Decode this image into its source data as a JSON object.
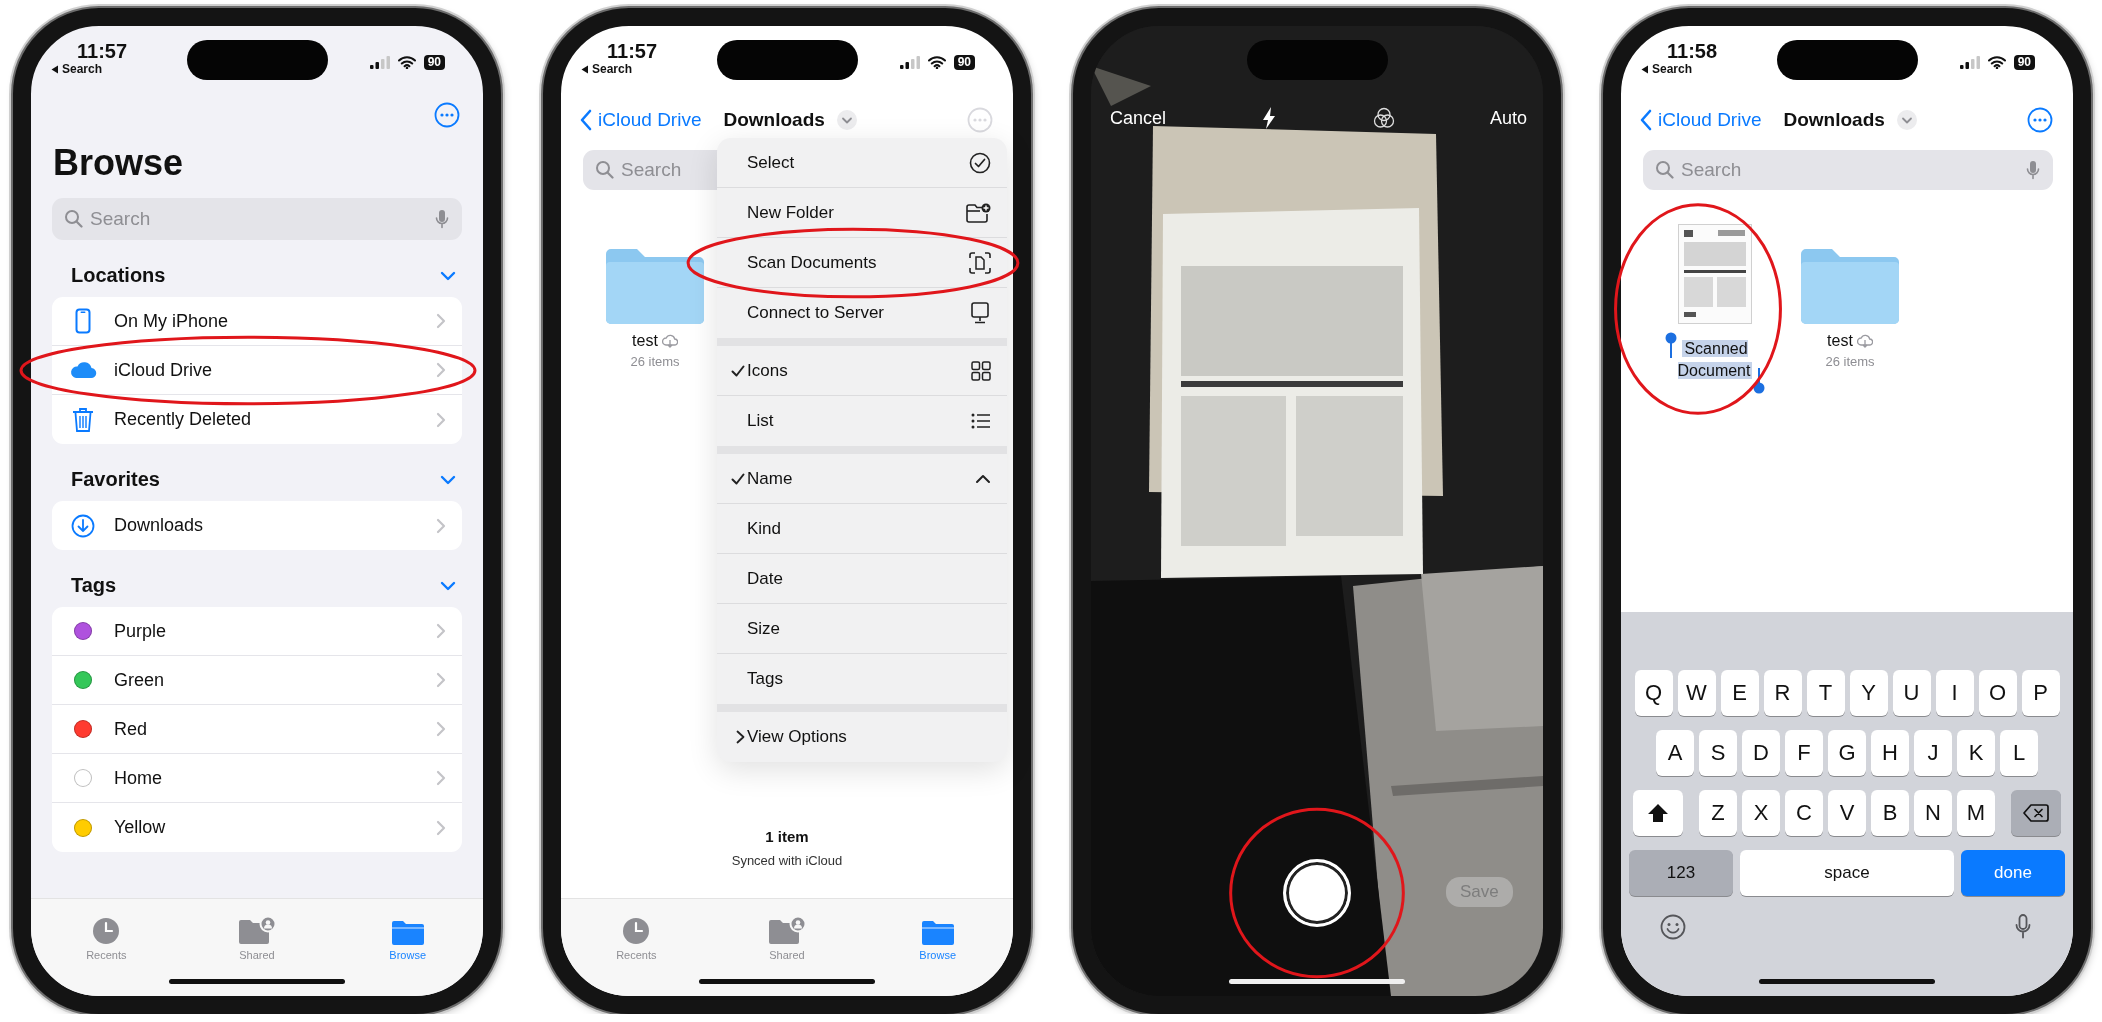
{
  "phones": [
    {
      "kind": "browse",
      "status": {
        "time": "11:57",
        "back_label": "Search",
        "battery": "90"
      },
      "more_dimmed": false,
      "title": "Browse",
      "search": {
        "placeholder": "Search"
      },
      "sections": [
        {
          "title": "Locations",
          "expanded": true,
          "items": [
            {
              "label": "On My iPhone",
              "circled": false
            },
            {
              "label": "iCloud Drive",
              "circled": true
            },
            {
              "label": "Recently Deleted",
              "circled": false
            }
          ]
        },
        {
          "title": "Favorites",
          "expanded": true,
          "items": [
            {
              "label": "Downloads",
              "circled": false
            }
          ]
        },
        {
          "title": "Tags",
          "expanded": true,
          "items": [
            {
              "label": "Purple",
              "color": "#af52de",
              "circled": false
            },
            {
              "label": "Green",
              "color": "#34c759",
              "circled": false
            },
            {
              "label": "Red",
              "color": "#ff3b30",
              "circled": false
            },
            {
              "label": "Home",
              "color": "#ffffff",
              "circled": false
            },
            {
              "label": "Yellow",
              "color": "#ffcc00",
              "circled": false
            }
          ]
        }
      ],
      "tab_bar": [
        {
          "label": "Recents",
          "selected": false
        },
        {
          "label": "Shared",
          "selected": false
        },
        {
          "label": "Browse",
          "selected": true
        }
      ]
    },
    {
      "kind": "files",
      "status": {
        "time": "11:57",
        "back_label": "Search",
        "battery": "90"
      },
      "nav": {
        "back_label": "iCloud Drive",
        "title": "Downloads",
        "more_dimmed": true
      },
      "search": {
        "placeholder": "Search"
      },
      "items": [
        {
          "kind": "folder",
          "name": "test",
          "detail": "26 items",
          "cloud": true,
          "editing": false,
          "circled": false
        }
      ],
      "footer": {
        "count": "1 item",
        "sync": "Synced with iCloud"
      },
      "menu": {
        "groups": [
          [
            {
              "label": "Select",
              "kind": "action",
              "checked": false,
              "circled": false
            },
            {
              "label": "New Folder",
              "kind": "action",
              "checked": false,
              "circled": false
            },
            {
              "label": "Scan Documents",
              "kind": "action",
              "checked": false,
              "circled": true
            },
            {
              "label": "Connect to Server",
              "kind": "action",
              "checked": false,
              "circled": false
            }
          ],
          [
            {
              "label": "Icons",
              "kind": "action",
              "checked": true,
              "circled": false
            },
            {
              "label": "List",
              "kind": "action",
              "checked": false,
              "circled": false
            }
          ],
          [
            {
              "label": "Name",
              "kind": "action",
              "checked": true,
              "circled": false
            },
            {
              "label": "Kind",
              "kind": "action",
              "checked": false,
              "circled": false
            },
            {
              "label": "Date",
              "kind": "action",
              "checked": false,
              "circled": false
            },
            {
              "label": "Size",
              "kind": "action",
              "checked": false,
              "circled": false
            },
            {
              "label": "Tags",
              "kind": "action",
              "checked": false,
              "circled": false
            }
          ],
          [
            {
              "label": "View Options",
              "kind": "submenu",
              "checked": false,
              "circled": false
            }
          ]
        ]
      },
      "tab_bar": [
        {
          "label": "Recents",
          "selected": false
        },
        {
          "label": "Shared",
          "selected": false
        },
        {
          "label": "Browse",
          "selected": true
        }
      ]
    },
    {
      "kind": "camera",
      "top_bar": {
        "cancel": "Cancel",
        "mode": "Auto"
      },
      "shutter": {
        "circled": true
      },
      "save_button": {
        "label": "Save",
        "disabled": true
      }
    },
    {
      "kind": "files",
      "status": {
        "time": "11:58",
        "back_label": "Search",
        "battery": "90"
      },
      "nav": {
        "back_label": "iCloud Drive",
        "title": "Downloads",
        "more_dimmed": false
      },
      "search": {
        "placeholder": "Search"
      },
      "items": [
        {
          "kind": "document",
          "name": "Scanned Document",
          "cloud": false,
          "editing": true,
          "circled": true
        },
        {
          "kind": "folder",
          "name": "test",
          "detail": "26 items",
          "cloud": true,
          "editing": false,
          "circled": false
        }
      ],
      "keyboard": {
        "rows": [
          [
            "Q",
            "W",
            "E",
            "R",
            "T",
            "Y",
            "U",
            "I",
            "O",
            "P"
          ],
          [
            "A",
            "S",
            "D",
            "F",
            "G",
            "H",
            "J",
            "K",
            "L"
          ],
          [
            "Z",
            "X",
            "C",
            "V",
            "B",
            "N",
            "M"
          ]
        ],
        "numbers_key": "123",
        "space_key": "space",
        "return_key": "done"
      }
    }
  ]
}
